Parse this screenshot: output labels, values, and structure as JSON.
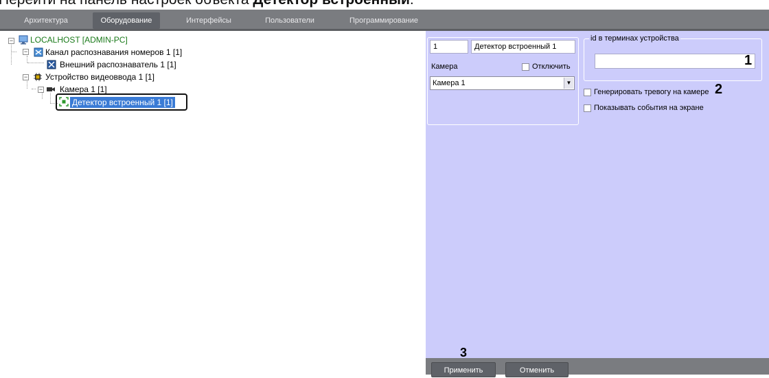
{
  "caption": {
    "prefix": "Перейти на панель настроек объекта ",
    "bold": "Детектор встроенный",
    "suffix": "."
  },
  "tabs": [
    {
      "label": "Архитектура",
      "active": false
    },
    {
      "label": "Оборудование",
      "active": true
    },
    {
      "label": "Интерфейсы",
      "active": false
    },
    {
      "label": "Пользователи",
      "active": false
    },
    {
      "label": "Программирование",
      "active": false
    }
  ],
  "tree": {
    "root": {
      "label": "LOCALHOST [ADMIN-PC]",
      "icon": "monitor-icon",
      "expander": "−"
    },
    "channel": {
      "label": "Канал распознавания номеров 1 [1]",
      "icon": "recognition-channel-icon",
      "expander": "−"
    },
    "recognizer": {
      "label": "Внешний распознаватель 1 [1]",
      "icon": "recognizer-icon"
    },
    "video_device": {
      "label": "Устройство видеоввода 1 [1]",
      "icon": "chip-icon",
      "expander": "−"
    },
    "camera": {
      "label": "Камера 1 [1]",
      "icon": "camera-icon",
      "expander": "−"
    },
    "detector": {
      "label": "Детектор встроенный 1 [1]",
      "icon": "detector-icon",
      "selected": true
    }
  },
  "settings": {
    "id_value": "1",
    "name_value": "Детектор встроенный 1",
    "camera_label": "Камера",
    "disable_label": "Отключить",
    "camera_select": "Камера 1",
    "device_id_group_title": "id в терминах устройства",
    "device_id_value": "",
    "alarm_on_camera_label": "Генерировать тревогу на камере",
    "show_events_label": "Показывать события на экране"
  },
  "annotations": {
    "one": "1",
    "two": "2",
    "three": "3"
  },
  "buttons": {
    "apply": "Применить",
    "cancel": "Отменить"
  },
  "colors": {
    "panel_bg": "#ccccfb",
    "tab_bar": "#7a7c80",
    "selection": "#3a7bd5",
    "host_text": "#1a7a1a"
  }
}
